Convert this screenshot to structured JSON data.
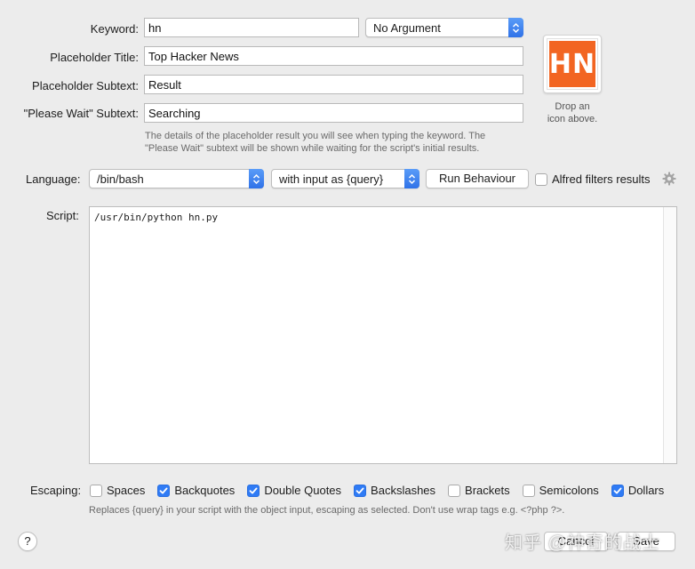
{
  "keyword": {
    "label": "Keyword:",
    "value": "hn"
  },
  "argument_popup": {
    "value": "No Argument"
  },
  "placeholder_title": {
    "label": "Placeholder Title:",
    "value": "Top Hacker News"
  },
  "placeholder_subtext": {
    "label": "Placeholder Subtext:",
    "value": "Result"
  },
  "please_wait_subtext": {
    "label": "\"Please Wait\" Subtext:",
    "value": "Searching"
  },
  "placeholder_hint": {
    "line1": "The details of the placeholder result you will see when typing the keyword. The",
    "line2": "\"Please Wait\" subtext will be shown while waiting for the script's initial results."
  },
  "icon_well": {
    "logo_text": "HN",
    "caption_line1": "Drop an",
    "caption_line2": "icon above."
  },
  "language": {
    "label": "Language:",
    "value": "/bin/bash",
    "input_mode": "with input as {query}",
    "run_behaviour_label": "Run Behaviour",
    "alfred_filters_label": "Alfred filters results",
    "alfred_filters_checked": false
  },
  "script": {
    "label": "Script:",
    "content": "/usr/bin/python hn.py"
  },
  "escaping": {
    "label": "Escaping:",
    "options": [
      {
        "label": "Spaces",
        "checked": false
      },
      {
        "label": "Backquotes",
        "checked": true
      },
      {
        "label": "Double Quotes",
        "checked": true
      },
      {
        "label": "Backslashes",
        "checked": true
      },
      {
        "label": "Brackets",
        "checked": false
      },
      {
        "label": "Semicolons",
        "checked": false
      },
      {
        "label": "Dollars",
        "checked": true
      }
    ],
    "hint": "Replaces {query} in your script with the object input, escaping as selected. Don't use wrap tags e.g. <?php ?>."
  },
  "footer": {
    "help_label": "?",
    "cancel_label": "Cancel",
    "save_label": "Save",
    "watermark": "知乎 @神奇的战士"
  },
  "colors": {
    "accent": "#2f7bf5",
    "hn_orange": "#f26522"
  }
}
